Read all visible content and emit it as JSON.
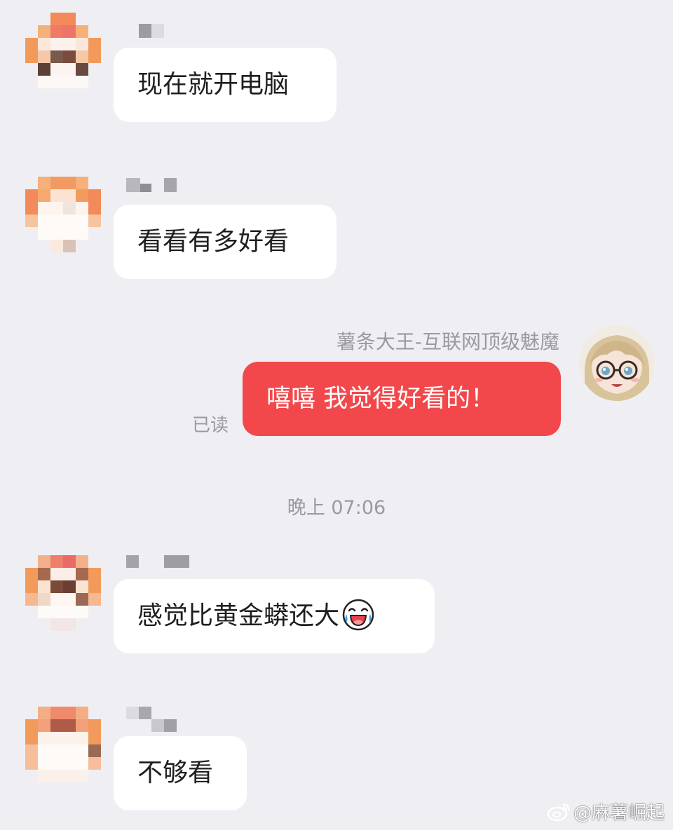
{
  "messages": [
    {
      "text": "现在就开电脑"
    },
    {
      "text": "看看有多好看"
    },
    {
      "sender_name": "薯条大王-互联网顶级魅魔",
      "text": "嘻嘻 我觉得好看的！",
      "read_status": "已读"
    },
    {
      "text": "感觉比黄金蟒还大"
    },
    {
      "text": "不够看"
    }
  ],
  "timestamp": "晚上 07:06",
  "emoji": "laughing-crying-emoji",
  "watermark": "@麻薯崛起",
  "colors": {
    "background": "#efeff3",
    "bubble_other": "#ffffff",
    "bubble_self": "#f2484c",
    "meta_text": "#9a9a9e"
  }
}
